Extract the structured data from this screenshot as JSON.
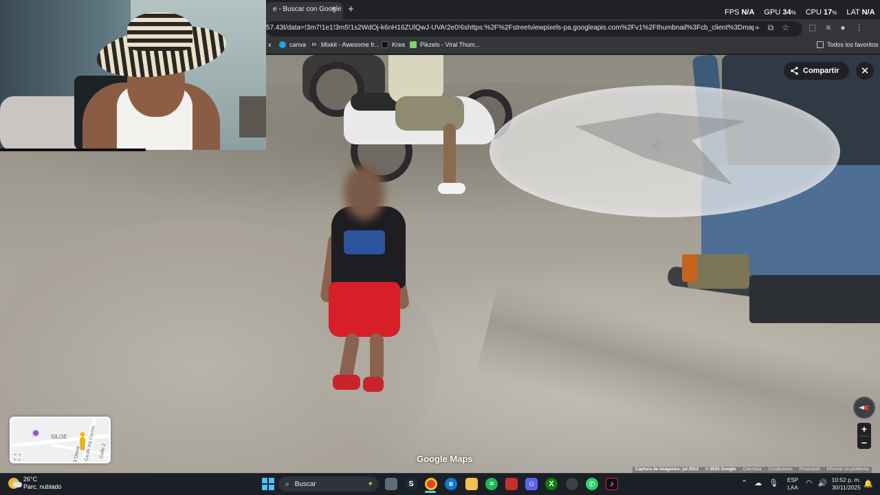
{
  "browser": {
    "tab_title": "e - Buscar con Google",
    "tab_close": "×",
    "new_tab": "+",
    "url": "57.43t/data=!3m7!1e1!3m5!1s2WdOj-k6nH16ZUlQwJ-UVA!2e0!6shttps:%2F%2Fstreetviewpixels-pa.googleapis.com%2Fv1%2Fthumbnail%3Fcb_client%3Dmaps_sv.tactile%..."
  },
  "overlay_stats": {
    "fps_label": "FPS",
    "fps_value": "N/A",
    "gpu_label": "GPU",
    "gpu_value": "34",
    "cpu_label": "CPU",
    "cpu_value": "17",
    "lat_label": "LAT",
    "lat_value": "N/A",
    "percent": "%"
  },
  "bookmarks": {
    "items": [
      {
        "label": "x"
      },
      {
        "label": "canva"
      },
      {
        "label": "Mixkit - Awesome fr..."
      },
      {
        "label": "Krea"
      },
      {
        "label": "Pikzels - Viral Thum..."
      }
    ],
    "all_favorites": "Todos los favoritos"
  },
  "streetview": {
    "share_label": "Compartir",
    "close_glyph": "✕",
    "zoom_in": "+",
    "zoom_out": "−",
    "logo": "Google Maps",
    "minimap": {
      "place": "SILOE",
      "street1": "Ca de los Cerros",
      "street2": "Calle 2",
      "street3": "3 Oeste"
    },
    "attribution": {
      "capture": "Captura de imágenes: jul 2013",
      "copyright": "© 2025 Google",
      "country": "Colombia",
      "terms": "Condiciones",
      "privacy": "Privacidad",
      "report": "Informar un problema"
    }
  },
  "taskbar": {
    "weather_temp": "26°C",
    "weather_desc": "Parc. nublado",
    "search_placeholder": "Buscar",
    "lang_line1": "ESP",
    "lang_line2": "LAA",
    "time": "10:52 p. m.",
    "date": "30/11/2025"
  },
  "colors": {
    "accent": "#60cdff",
    "chrome_bg": "#202124",
    "shorts_red": "#d61f26"
  }
}
